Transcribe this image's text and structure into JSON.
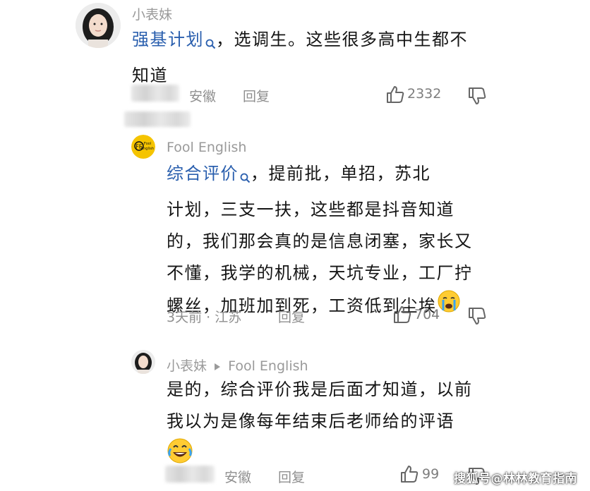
{
  "comments": [
    {
      "user": "小表妹",
      "link_text": "强基计划",
      "text_line1": "，选调生。这些很多高中生都不",
      "text_line2": "知道",
      "location": "安徽",
      "reply_label": "回复",
      "likes": "2332"
    },
    {
      "user": "Fool English",
      "link_text": "综合评价",
      "line1_rest": "，提前批，单招，苏北",
      "line2": "计划，三支一扶，这些都是抖音知道",
      "line3": "的，我们那会真的是信息闭塞，家长又",
      "line4": "不懂，我学的机械，天坑专业，工厂拧",
      "line5": "螺丝，加班加到死，工资低到尘埃",
      "meta": "3天前 · 江苏",
      "reply_label": "回复",
      "likes": "704"
    },
    {
      "user": "小表妹",
      "reply_to": "Fool English",
      "line1": "是的，综合评价我是后面才知道，以前",
      "line2": "我以为是像每年结束后老师给的评语",
      "location": "安徽",
      "reply_label": "回复",
      "likes": "99"
    }
  ],
  "icons": {
    "search": "search-icon",
    "like": "thumb-up-icon",
    "dislike": "thumb-down-icon",
    "cry_emoji": "crying-face-emoji",
    "laugh_emoji": "tears-of-joy-emoji",
    "reply_arrow": "triangle-right-icon"
  },
  "avatar_logo_text": "Fool English",
  "watermark": "搜狐号@林林教育指南",
  "colors": {
    "link": "#2a5fae",
    "muted": "#9a9a9a",
    "text": "#151515"
  }
}
